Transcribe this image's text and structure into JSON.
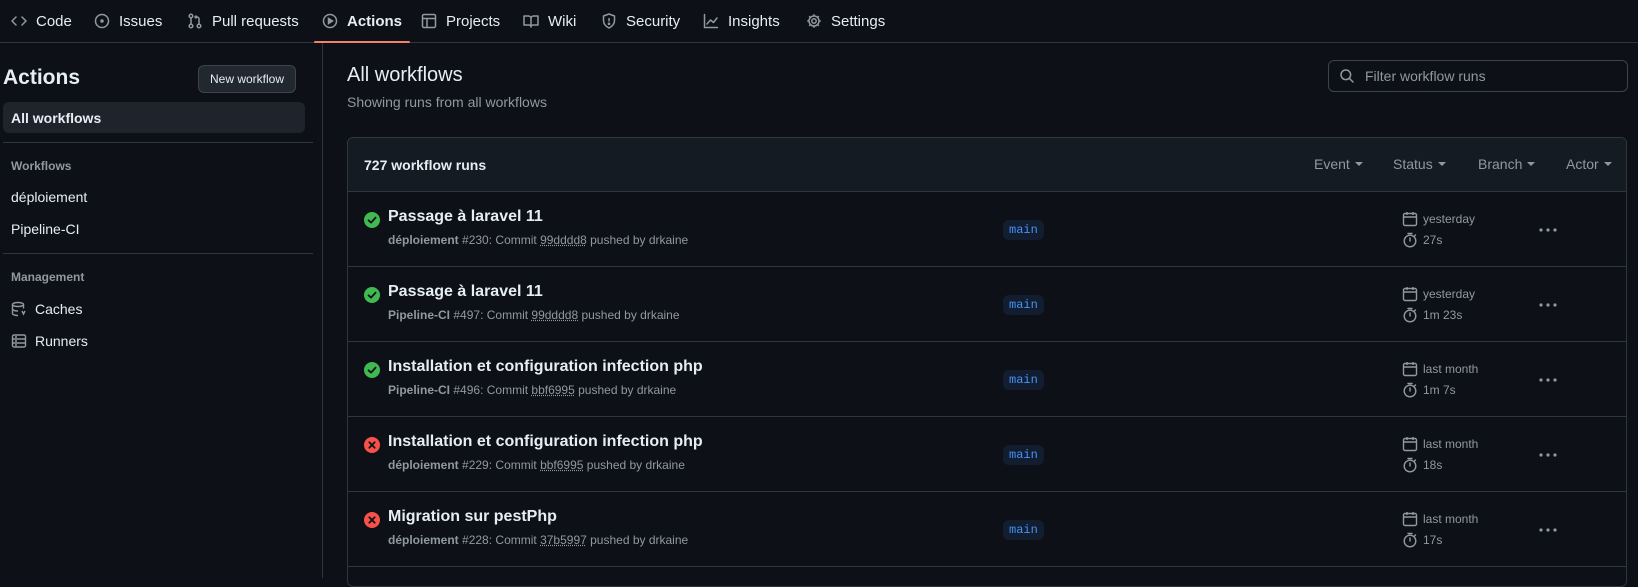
{
  "nav": {
    "tabs": [
      {
        "label": "Code",
        "icon": "code-icon"
      },
      {
        "label": "Issues",
        "icon": "issue-opened-icon"
      },
      {
        "label": "Pull requests",
        "icon": "git-pull-request-icon"
      },
      {
        "label": "Actions",
        "icon": "play-icon",
        "active": true
      },
      {
        "label": "Projects",
        "icon": "table-icon"
      },
      {
        "label": "Wiki",
        "icon": "book-icon"
      },
      {
        "label": "Security",
        "icon": "shield-icon"
      },
      {
        "label": "Insights",
        "icon": "graph-icon"
      },
      {
        "label": "Settings",
        "icon": "gear-icon"
      }
    ],
    "active_color": "#f78166"
  },
  "sidebar": {
    "title": "Actions",
    "new_workflow_label": "New workflow",
    "all_workflows_label": "All workflows",
    "workflows_heading": "Workflows",
    "workflows": [
      "déploiement",
      "Pipeline-CI"
    ],
    "management_heading": "Management",
    "management_items": [
      {
        "label": "Caches",
        "icon": "database-icon"
      },
      {
        "label": "Runners",
        "icon": "server-icon"
      }
    ]
  },
  "main": {
    "title": "All workflows",
    "subtitle": "Showing runs from all workflows",
    "filter_placeholder": "Filter workflow runs",
    "runs_count": "727 workflow runs",
    "filters": [
      "Event",
      "Status",
      "Branch",
      "Actor"
    ],
    "runs": [
      {
        "status": "success",
        "title": "Passage à laravel 11",
        "workflow": "déploiement",
        "number": "#230",
        "commit_prefix": ": Commit ",
        "sha": "99dddd8",
        "pushed_by": " pushed by drkaine",
        "branch": "main",
        "when": "yesterday",
        "duration": "27s"
      },
      {
        "status": "success",
        "title": "Passage à laravel 11",
        "workflow": "Pipeline-CI",
        "number": "#497",
        "commit_prefix": ": Commit ",
        "sha": "99dddd8",
        "pushed_by": " pushed by drkaine",
        "branch": "main",
        "when": "yesterday",
        "duration": "1m 23s"
      },
      {
        "status": "success",
        "title": "Installation et configuration infection php",
        "workflow": "Pipeline-CI",
        "number": "#496",
        "commit_prefix": ": Commit ",
        "sha": "bbf6995",
        "pushed_by": " pushed by drkaine",
        "branch": "main",
        "when": "last month",
        "duration": "1m 7s"
      },
      {
        "status": "failure",
        "title": "Installation et configuration infection php",
        "workflow": "déploiement",
        "number": "#229",
        "commit_prefix": ": Commit ",
        "sha": "bbf6995",
        "pushed_by": " pushed by drkaine",
        "branch": "main",
        "when": "last month",
        "duration": "18s"
      },
      {
        "status": "failure",
        "title": "Migration sur pestPhp",
        "workflow": "déploiement",
        "number": "#228",
        "commit_prefix": ": Commit ",
        "sha": "37b5997",
        "pushed_by": " pushed by drkaine",
        "branch": "main",
        "when": "last month",
        "duration": "17s"
      }
    ]
  },
  "colors": {
    "success": "#3fb950",
    "failure": "#f85149",
    "branch_text": "#4493f8",
    "branch_bg": "#121d2f"
  }
}
